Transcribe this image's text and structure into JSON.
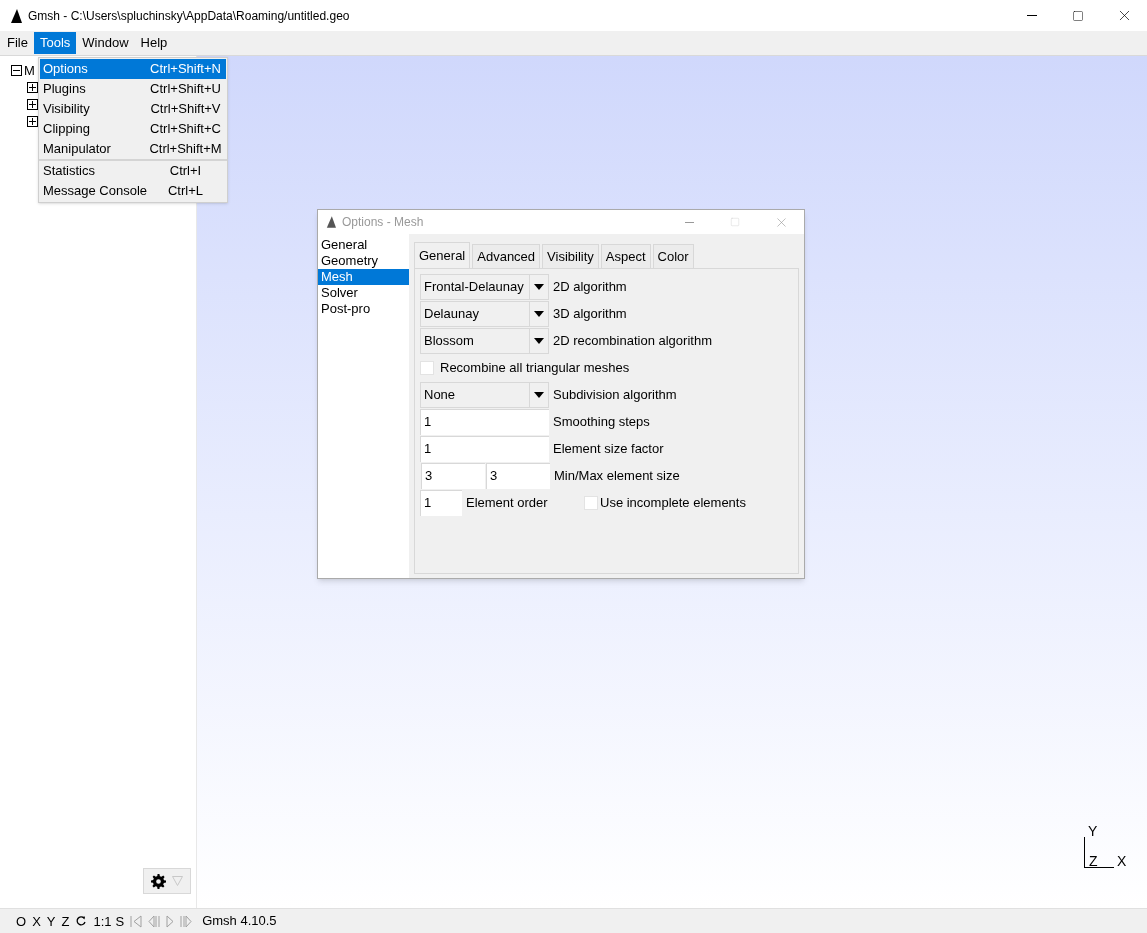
{
  "window": {
    "title": "Gmsh - C:\\Users\\spluchinsky\\AppData\\Roaming/untitled.geo"
  },
  "menu_bar": [
    {
      "label": "File",
      "selected": false
    },
    {
      "label": "Tools",
      "selected": true
    },
    {
      "label": "Window",
      "selected": false
    },
    {
      "label": "Help",
      "selected": false
    }
  ],
  "tools_menu": {
    "groups": [
      [
        {
          "label": "Options",
          "shortcut": "Ctrl+Shift+N",
          "selected": true
        },
        {
          "label": "Plugins",
          "shortcut": "Ctrl+Shift+U",
          "selected": false
        },
        {
          "label": "Visibility",
          "shortcut": "Ctrl+Shift+V",
          "selected": false
        },
        {
          "label": "Clipping",
          "shortcut": "Ctrl+Shift+C",
          "selected": false
        },
        {
          "label": "Manipulator",
          "shortcut": "Ctrl+Shift+M",
          "selected": false
        }
      ],
      [
        {
          "label": "Statistics",
          "shortcut": "Ctrl+I",
          "selected": false
        },
        {
          "label": "Message Console",
          "shortcut": "Ctrl+L",
          "selected": false
        }
      ]
    ]
  },
  "tree": {
    "label": "M",
    "expanded": true,
    "children": [
      {
        "expanded": false
      },
      {
        "expanded": false
      },
      {
        "expanded": false
      }
    ]
  },
  "axes": {
    "y": "Y",
    "z": "Z",
    "x": "X"
  },
  "status_bar": {
    "view_buttons": [
      "O",
      "X",
      "Y",
      "Z"
    ],
    "scale": "1:1",
    "s_button": "S",
    "version": "Gmsh 4.10.5"
  },
  "options_dialog": {
    "title": "Options - Mesh",
    "categories": [
      {
        "label": "General",
        "selected": false
      },
      {
        "label": "Geometry",
        "selected": false
      },
      {
        "label": "Mesh",
        "selected": true
      },
      {
        "label": "Solver",
        "selected": false
      },
      {
        "label": "Post-pro",
        "selected": false
      }
    ],
    "tabs": [
      {
        "label": "General",
        "selected": true
      },
      {
        "label": "Advanced",
        "selected": false
      },
      {
        "label": "Visibility",
        "selected": false
      },
      {
        "label": "Aspect",
        "selected": false
      },
      {
        "label": "Color",
        "selected": false
      }
    ],
    "fields": [
      {
        "kind": "select",
        "value": "Frontal-Delaunay",
        "label": "2D algorithm"
      },
      {
        "kind": "select",
        "value": "Delaunay",
        "label": "3D algorithm"
      },
      {
        "kind": "select",
        "value": "Blossom",
        "label": "2D recombination algorithm"
      },
      {
        "kind": "checkbox",
        "checked": false,
        "text": "Recombine all triangular meshes"
      },
      {
        "kind": "select",
        "value": "None",
        "label": "Subdivision algorithm"
      },
      {
        "kind": "input",
        "value": "1",
        "label": "Smoothing steps"
      },
      {
        "kind": "input",
        "value": "1",
        "label": "Element size factor"
      },
      {
        "kind": "pair",
        "values": [
          "3",
          "3"
        ],
        "label": "Min/Max element size"
      },
      {
        "kind": "order",
        "value": "1",
        "label": "Element order",
        "option": {
          "label": "Use incomplete elements",
          "checked": false
        }
      }
    ]
  }
}
